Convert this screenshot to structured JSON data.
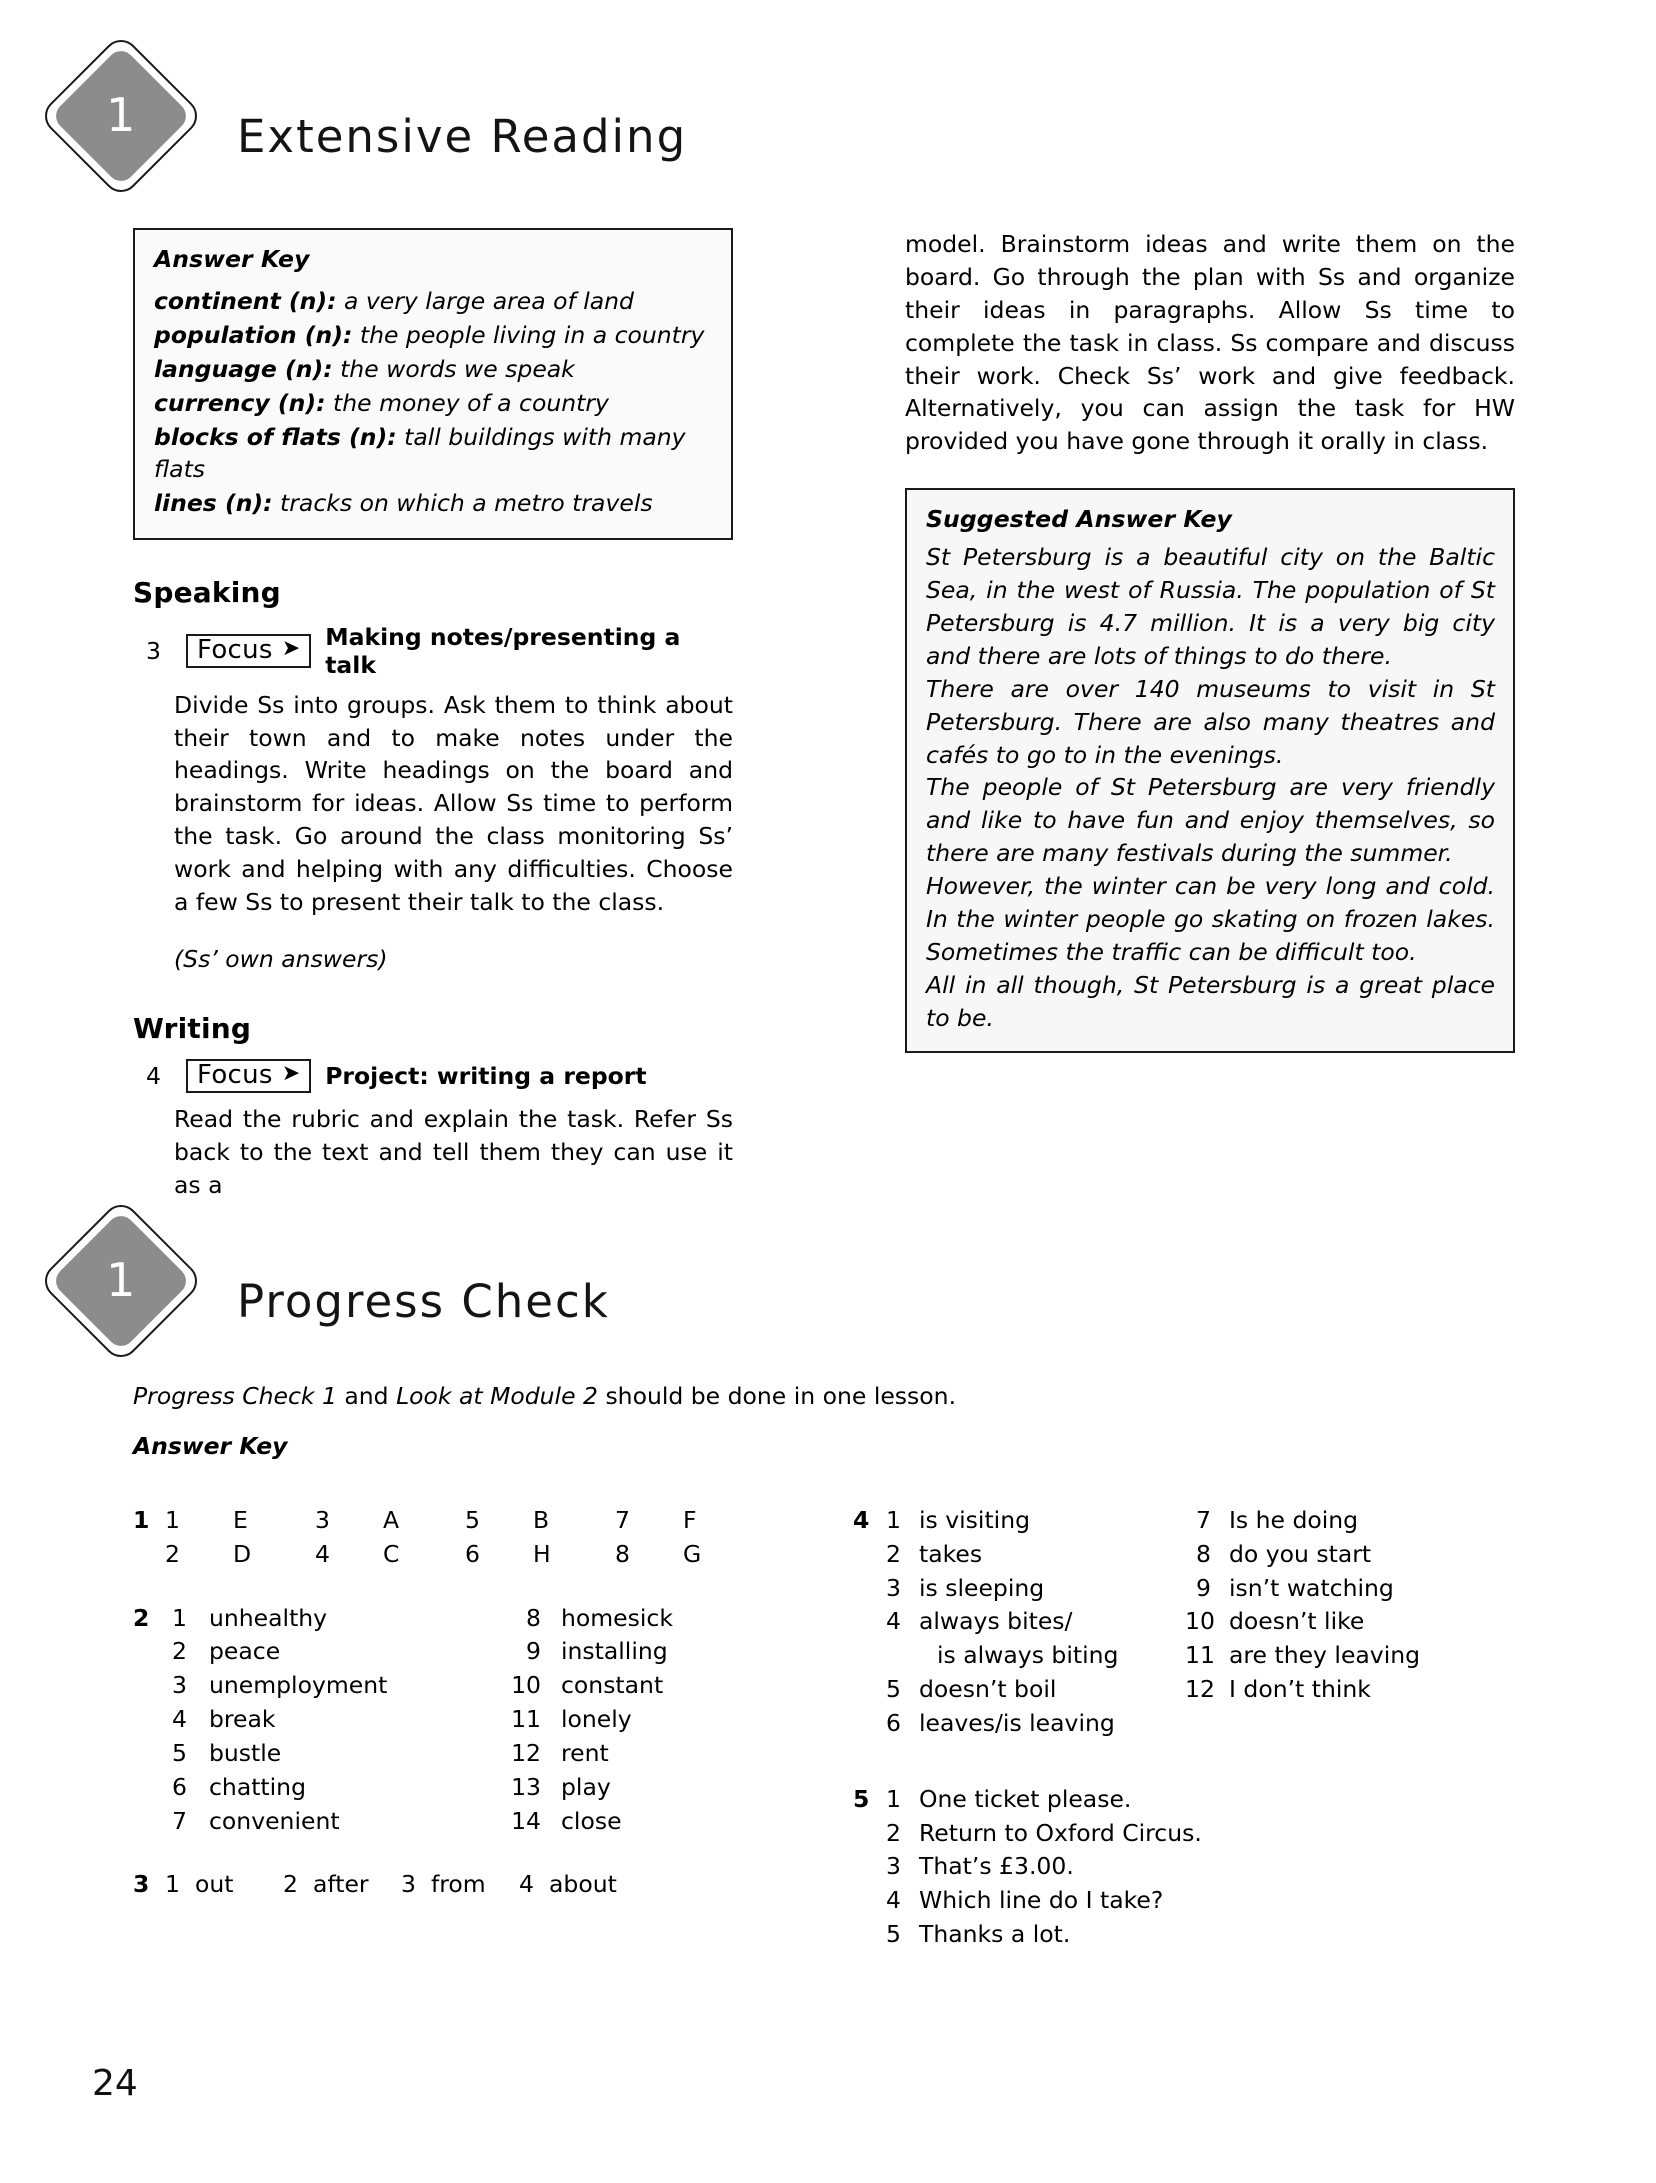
{
  "module_badge_1": {
    "number": "1",
    "title": "Extensive Reading"
  },
  "module_badge_2": {
    "number": "1",
    "title": "Progress Check"
  },
  "answer_key_box": {
    "title": "Answer Key",
    "entries": [
      {
        "term": "continent (n):",
        "definition": "a very large area of land"
      },
      {
        "term": "population (n):",
        "definition": "the people living in a country"
      },
      {
        "term": "language (n):",
        "definition": "the words we speak"
      },
      {
        "term": "currency (n):",
        "definition": "the money of a country"
      },
      {
        "term": "blocks of flats (n):",
        "definition": "tall buildings with many flats"
      },
      {
        "term": "lines (n):",
        "definition": "tracks on which a metro travels"
      }
    ]
  },
  "speaking": {
    "heading": "Speaking",
    "exercise_number": "3",
    "focus_label": "Focus",
    "focus_arrow": "➤",
    "exercise_title": "Making notes/presenting a talk",
    "paragraph": "Divide Ss into groups. Ask them to think about their town and to make notes under the headings. Write headings on the board and brainstorm for ideas. Allow Ss time to perform the task. Go around the class monitoring Ss’ work and helping with any difficulties. Choose a few Ss to present their talk to the class.",
    "note": "(Ss’ own answers)"
  },
  "writing": {
    "heading": "Writing",
    "exercise_number": "4",
    "focus_label": "Focus",
    "focus_arrow": "➤",
    "exercise_title": "Project: writing a report",
    "paragraph_left": "Read the rubric and explain the task. Refer Ss back to the text and tell them they can use it as a",
    "paragraph_right": "model. Brainstorm ideas and write them on the board. Go through the plan with Ss and organize their ideas in paragraphs. Allow Ss time to complete the task in class. Ss compare and discuss their work. Check Ss’ work and give feedback. Alternatively, you can assign the task for HW provided you have gone through it orally in class."
  },
  "suggested_answer_key": {
    "title": "Suggested Answer Key",
    "paragraphs": [
      "St Petersburg is a beautiful city on the Baltic Sea, in the west of Russia. The population of St Petersburg is 4.7 million. It is a very big city and there are lots of things to do there.",
      "There are over 140 museums to visit in St Petersburg. There are also many theatres and cafés to go to in the evenings.",
      "The people of St Petersburg are very friendly and like to have fun and enjoy themselves, so there are many festivals during the summer.",
      "However, the winter can be very long and cold. In the winter people go skating on frozen lakes. Sometimes the traffic can be difficult too.",
      "All in all though, St Petersburg is a great place to be."
    ]
  },
  "progress_check": {
    "intro_italic_1": "Progress Check 1",
    "intro_roman_1": " and ",
    "intro_italic_2": "Look at Module 2",
    "intro_roman_2": " should be done in one lesson.",
    "answer_key_label": "Answer Key"
  },
  "answers": {
    "ex1": {
      "number": "1",
      "items": [
        {
          "n": "1",
          "v": "E"
        },
        {
          "n": "3",
          "v": "A"
        },
        {
          "n": "5",
          "v": "B"
        },
        {
          "n": "7",
          "v": "F"
        },
        {
          "n": "2",
          "v": "D"
        },
        {
          "n": "4",
          "v": "C"
        },
        {
          "n": "6",
          "v": "H"
        },
        {
          "n": "8",
          "v": "G"
        }
      ]
    },
    "ex2": {
      "number": "2",
      "left": [
        {
          "n": "1",
          "v": "unhealthy"
        },
        {
          "n": "2",
          "v": "peace"
        },
        {
          "n": "3",
          "v": "unemployment"
        },
        {
          "n": "4",
          "v": "break"
        },
        {
          "n": "5",
          "v": "bustle"
        },
        {
          "n": "6",
          "v": "chatting"
        },
        {
          "n": "7",
          "v": "convenient"
        }
      ],
      "right": [
        {
          "n": "8",
          "v": "homesick"
        },
        {
          "n": "9",
          "v": "installing"
        },
        {
          "n": "10",
          "v": "constant"
        },
        {
          "n": "11",
          "v": "lonely"
        },
        {
          "n": "12",
          "v": "rent"
        },
        {
          "n": "13",
          "v": "play"
        },
        {
          "n": "14",
          "v": "close"
        }
      ]
    },
    "ex3": {
      "number": "3",
      "items": [
        {
          "n": "1",
          "v": "out"
        },
        {
          "n": "2",
          "v": "after"
        },
        {
          "n": "3",
          "v": "from"
        },
        {
          "n": "4",
          "v": "about"
        }
      ]
    },
    "ex4": {
      "number": "4",
      "left": [
        {
          "n": "1",
          "v": "is visiting",
          "cont": ""
        },
        {
          "n": "2",
          "v": "takes",
          "cont": ""
        },
        {
          "n": "3",
          "v": "is sleeping",
          "cont": ""
        },
        {
          "n": "4",
          "v": "always bites/",
          "cont": "is always biting"
        },
        {
          "n": "5",
          "v": "doesn’t boil",
          "cont": ""
        },
        {
          "n": "6",
          "v": "leaves/is leaving",
          "cont": ""
        }
      ],
      "right": [
        {
          "n": "7",
          "v": "Is he doing"
        },
        {
          "n": "8",
          "v": "do you start"
        },
        {
          "n": "9",
          "v": "isn’t watching"
        },
        {
          "n": "10",
          "v": "doesn’t like"
        },
        {
          "n": "11",
          "v": "are they leaving"
        },
        {
          "n": "12",
          "v": "I don’t think"
        }
      ]
    },
    "ex5": {
      "number": "5",
      "items": [
        {
          "n": "1",
          "v": "One ticket please."
        },
        {
          "n": "2",
          "v": "Return to Oxford Circus."
        },
        {
          "n": "3",
          "v": "That’s £3.00."
        },
        {
          "n": "4",
          "v": "Which line do I take?"
        },
        {
          "n": "5",
          "v": "Thanks a lot."
        }
      ]
    }
  },
  "page_number": "24"
}
